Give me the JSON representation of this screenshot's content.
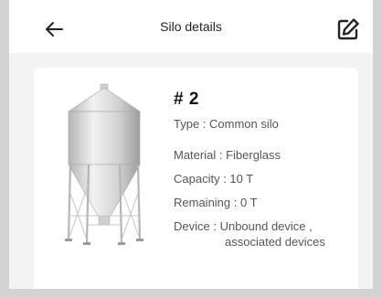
{
  "header": {
    "title": "Silo details",
    "back_icon": "arrow-left-icon",
    "edit_icon": "edit-square-icon"
  },
  "silo": {
    "number": "# 2",
    "type": "Type : Common silo",
    "material": "Material : Fiberglass",
    "capacity": "Capacity : 10 T",
    "remaining": "Remaining  : 0 T",
    "device_line1": "Device : Unbound device ,",
    "device_line2": "associated devices"
  }
}
